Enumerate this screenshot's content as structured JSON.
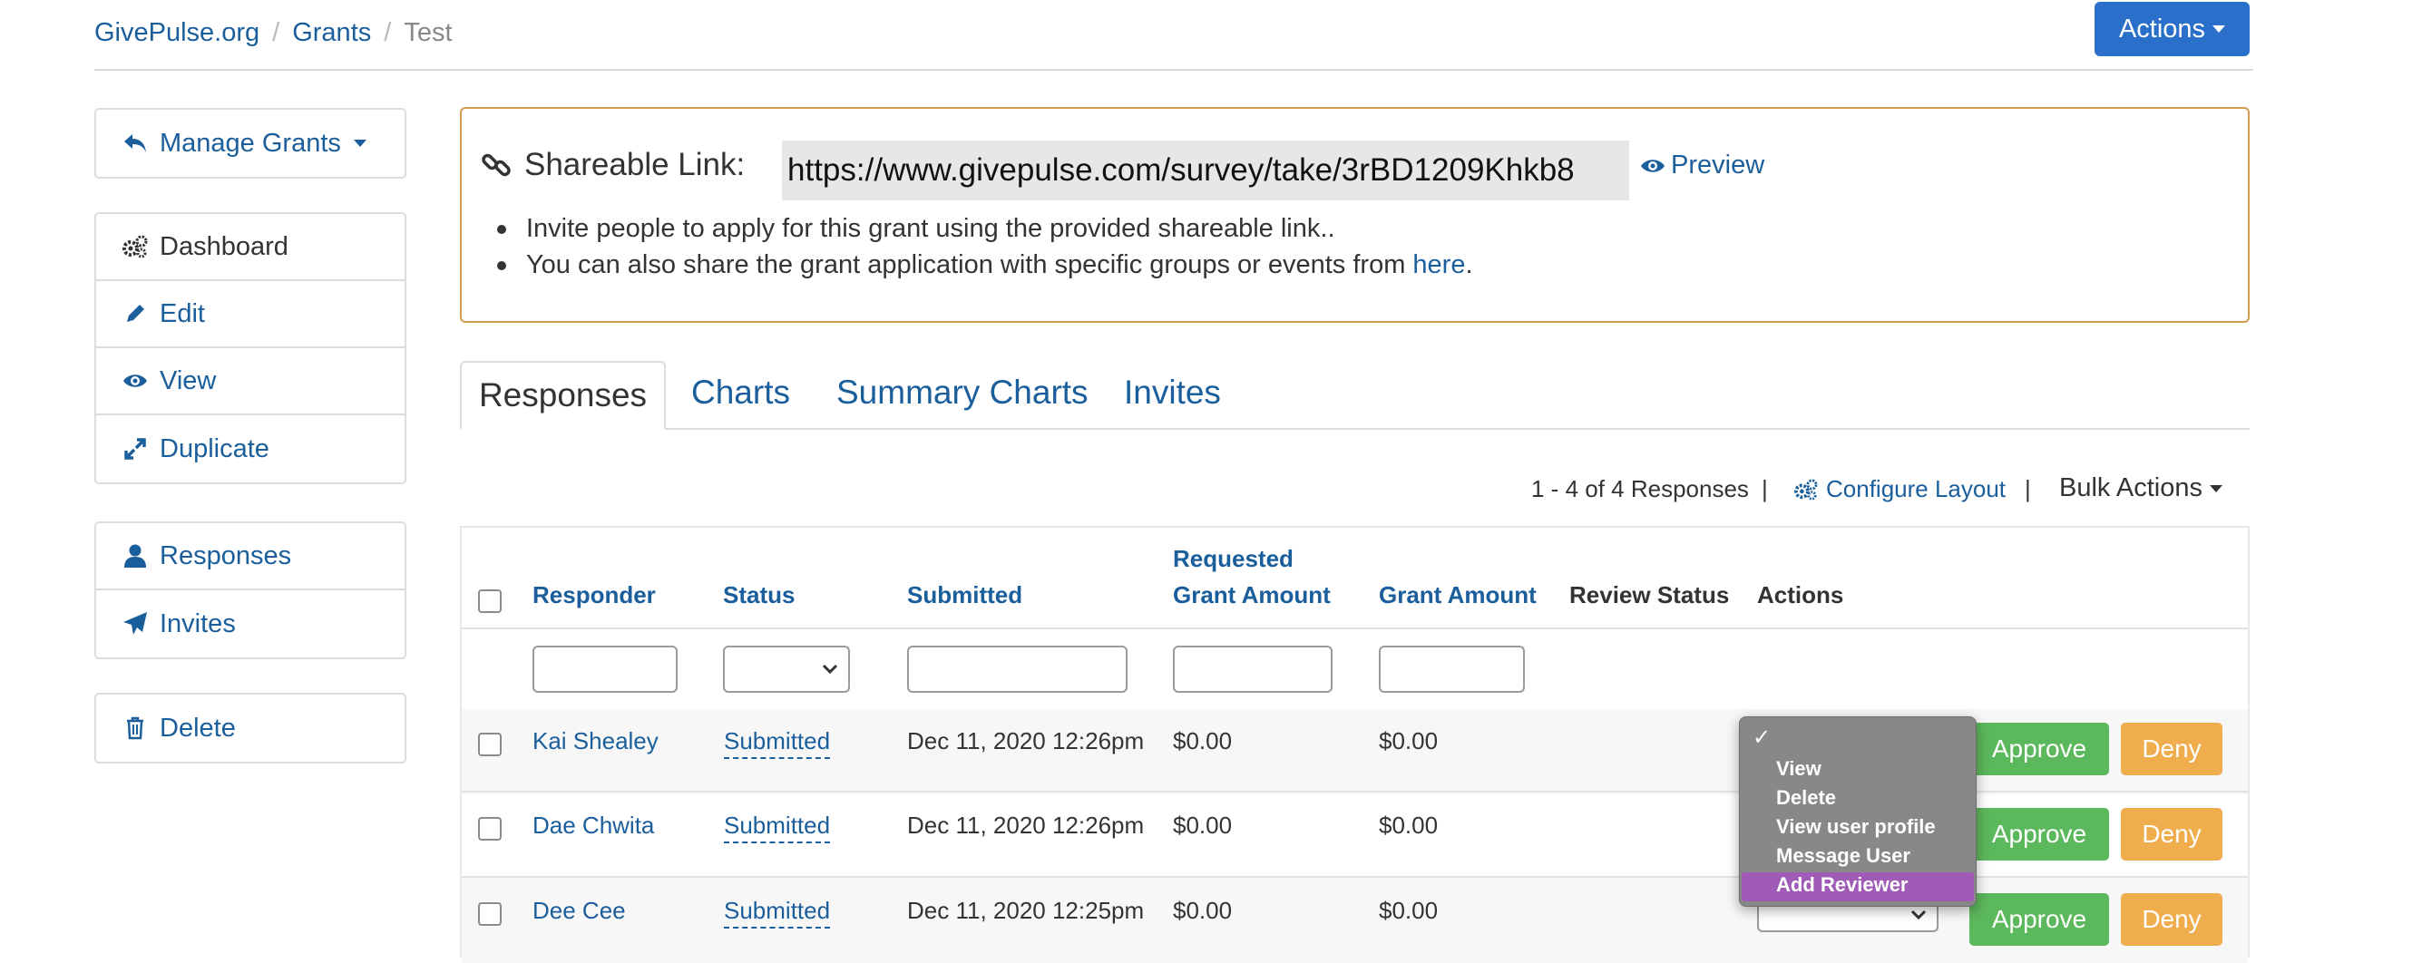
{
  "breadcrumb": {
    "items": [
      "GivePulse.org",
      "Grants",
      "Test"
    ],
    "sep": "/"
  },
  "header": {
    "actions_label": "Actions"
  },
  "sidebar": {
    "manage_label": "Manage Grants",
    "group1": [
      "Dashboard",
      "Edit",
      "View",
      "Duplicate"
    ],
    "group2": [
      "Responses",
      "Invites"
    ],
    "delete_label": "Delete"
  },
  "share": {
    "label": "Shareable Link:",
    "url": "https://www.givepulse.com/survey/take/3rBD1209Khkb8",
    "preview_label": "Preview",
    "bullet1": "Invite people to apply for this grant using the provided shareable link..",
    "bullet2_prefix": "You can also share the grant application with specific groups or events from ",
    "bullet2_link": "here",
    "bullet2_suffix": "."
  },
  "tabs": [
    "Responses",
    "Charts",
    "Summary Charts",
    "Invites"
  ],
  "toolbar": {
    "count_label": "1 - 4 of 4 Responses",
    "divider": "|",
    "configure_label": "Configure Layout",
    "bulk_label": "Bulk Actions"
  },
  "table": {
    "columns": {
      "responder": "Responder",
      "status": "Status",
      "submitted": "Submitted",
      "requested_1": "Requested",
      "requested_2": "Grant Amount",
      "grant": "Grant Amount",
      "review": "Review Status",
      "actions": "Actions"
    },
    "rows": [
      {
        "responder": "Kai Shealey",
        "status": "Submitted",
        "submitted": "Dec 11, 2020 12:26pm",
        "requested": "$0.00",
        "grant": "$0.00"
      },
      {
        "responder": "Dae Chwita",
        "status": "Submitted",
        "submitted": "Dec 11, 2020 12:26pm",
        "requested": "$0.00",
        "grant": "$0.00"
      },
      {
        "responder": "Dee Cee",
        "status": "Submitted",
        "submitted": "Dec 11, 2020 12:25pm",
        "requested": "$0.00",
        "grant": "$0.00"
      }
    ],
    "approve_label": "Approve",
    "deny_label": "Deny"
  },
  "menu": {
    "check": "✓",
    "options": [
      "View",
      "Delete",
      "View user profile",
      "Message User",
      "Add Reviewer"
    ],
    "highlighted": "Add Reviewer"
  },
  "colors": {
    "primary": "#2a6fc9",
    "link": "#1a5e9c",
    "approve": "#5cb85c",
    "deny": "#f0ad4e",
    "share_border": "#d39b52",
    "menu_bg": "#888888",
    "menu_highlight": "#a05bb6"
  }
}
